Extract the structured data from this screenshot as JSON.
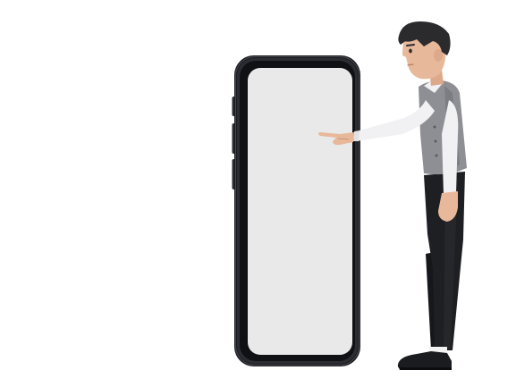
{
  "scene": {
    "subject": "man-pointing-at-phone",
    "icons": [
      "smartphone-icon",
      "person-icon"
    ]
  },
  "colors": {
    "background": "#ffffff",
    "phone_frame": "#1a1b1f",
    "phone_screen": "#e9e9ea",
    "shirt": "#f1f1f3",
    "vest": "#8e8f94",
    "trousers": "#1e1f22",
    "skin": "#e8b89a",
    "hair": "#2b2b2e"
  }
}
